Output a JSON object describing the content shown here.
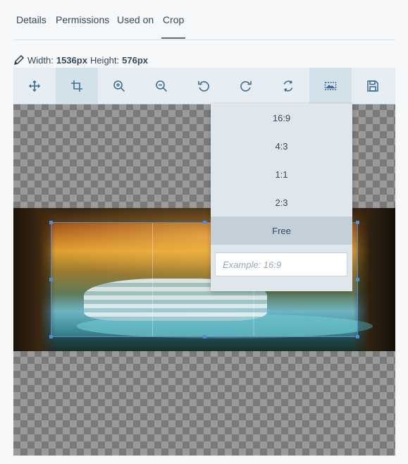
{
  "tabs": [
    {
      "label": "Details"
    },
    {
      "label": "Permissions"
    },
    {
      "label": "Used on"
    },
    {
      "label": "Crop",
      "active": true
    }
  ],
  "dimensions": {
    "width_label": "Width:",
    "width_value": "1536px",
    "height_label": "Height:",
    "height_value": "576px"
  },
  "toolbar": {
    "tools": [
      {
        "icon": "move-icon"
      },
      {
        "icon": "crop-icon",
        "active": true
      },
      {
        "icon": "zoom-in-icon"
      },
      {
        "icon": "zoom-out-icon"
      },
      {
        "icon": "rotate-left-icon"
      },
      {
        "icon": "rotate-right-icon"
      },
      {
        "icon": "reset-icon"
      },
      {
        "icon": "aspect-ratio-icon",
        "active": true
      },
      {
        "icon": "save-icon"
      }
    ]
  },
  "aspect_ratio_menu": {
    "options": [
      "16:9",
      "4:3",
      "1:1",
      "2:3",
      "Free"
    ],
    "selected": "Free",
    "custom_input": {
      "value": "",
      "placeholder": "Example: 16:9"
    }
  },
  "colors": {
    "accent": "#4a90d9",
    "toolbar_bg": "#e6edf3",
    "text": "#34495e"
  }
}
